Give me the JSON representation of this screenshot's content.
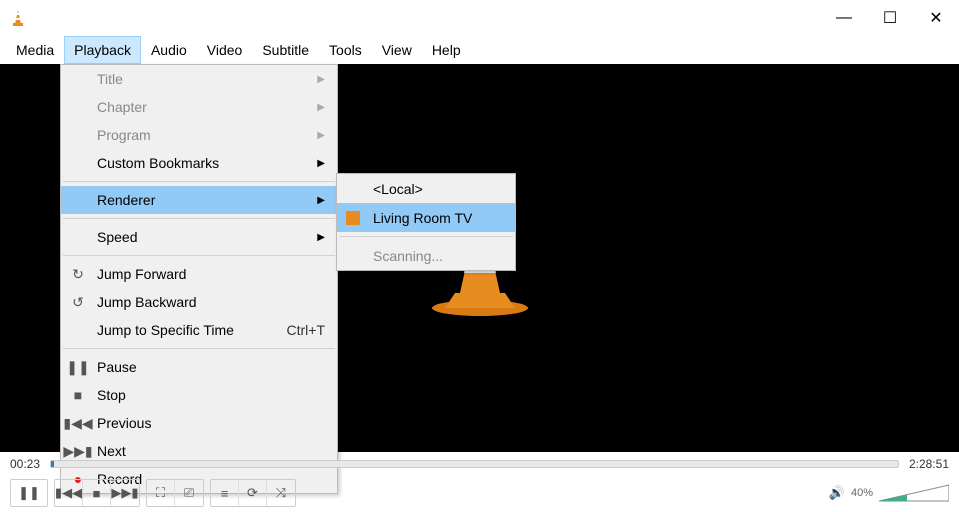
{
  "titlebar": {
    "title": ""
  },
  "windowControls": {
    "min": "—",
    "max": "☐",
    "close": "✕"
  },
  "menubar": [
    "Media",
    "Playback",
    "Audio",
    "Video",
    "Subtitle",
    "Tools",
    "View",
    "Help"
  ],
  "menubarActiveIndex": 1,
  "playbackMenu": {
    "title": "Title",
    "chapter": "Chapter",
    "program": "Program",
    "customBookmarks": "Custom Bookmarks",
    "renderer": "Renderer",
    "speed": "Speed",
    "jumpForward": "Jump Forward",
    "jumpBackward": "Jump Backward",
    "jumpToTime": "Jump to Specific Time",
    "jumpToTimeShortcut": "Ctrl+T",
    "pause": "Pause",
    "stop": "Stop",
    "previous": "Previous",
    "next": "Next",
    "record": "Record"
  },
  "rendererSubmenu": {
    "local": "<Local>",
    "device": "Living Room TV",
    "scanning": "Scanning..."
  },
  "time": {
    "elapsed": "00:23",
    "total": "2:28:51"
  },
  "volume": {
    "percent": "40%"
  }
}
